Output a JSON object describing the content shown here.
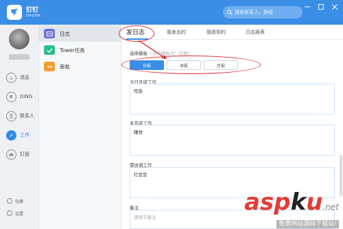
{
  "app": {
    "brand": "钉钉",
    "brand_sub": "DingTalk"
  },
  "search": {
    "placeholder": "搜索联系人，群组"
  },
  "leftnav": {
    "items": [
      {
        "label": "消息"
      },
      {
        "label": "DING"
      },
      {
        "label": "联系人"
      },
      {
        "label": "工作"
      },
      {
        "label": "钉盘"
      }
    ],
    "bottom": [
      {
        "label": "创建"
      },
      {
        "label": "设置"
      }
    ]
  },
  "sidebar": {
    "items": [
      {
        "label": "日志"
      },
      {
        "label": "Tower任务"
      },
      {
        "label": "审批"
      }
    ]
  },
  "tabs": [
    {
      "label": "发日志"
    },
    {
      "label": "我发出的"
    },
    {
      "label": "我收到的"
    },
    {
      "label": "日志报表"
    }
  ],
  "form": {
    "template_label": "选择模板",
    "template_hint": "（当前模板为：日报）",
    "templates": [
      "日报",
      "周报",
      "月报"
    ],
    "today_done_label": "今日完成工作",
    "today_done_value": "吃饭",
    "unfinished_label": "未完成工作",
    "unfinished_value": "睡觉",
    "coordinate_label": "需协调工作",
    "coordinate_value": "打豆豆",
    "note_label": "备注",
    "note_placeholder": "请填写备注"
  },
  "watermark": {
    "main_a": "asp",
    "main_k": "k",
    "main_u": "u",
    "net": ".net",
    "sub": "免费网站源码下载站!"
  },
  "colors": {
    "accent": "#3a8ee6",
    "highlight": "#d9343c"
  }
}
